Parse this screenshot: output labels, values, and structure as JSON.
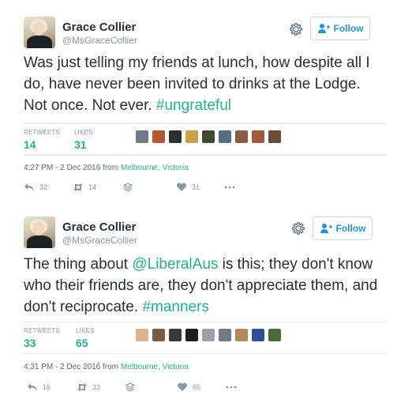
{
  "tweets": [
    {
      "author": {
        "name": "Grace Collier",
        "handle": "@MsGraceCollier"
      },
      "follow_label": "Follow",
      "text": {
        "before": "Was just telling my friends at lunch, how despite all I do, have never been invited to drinks at the Lodge. Not once. Not ever. ",
        "hashtag": "#ungrateful",
        "after": ""
      },
      "stats": {
        "retweets_label": "RETWEETS",
        "retweets": "14",
        "likes_label": "LIKES",
        "likes": "31"
      },
      "timestamp": "4:27 PM - 2 Dec 2016 from",
      "location": "Melbourne, Victoria",
      "actions": {
        "reply": "32",
        "retweet": "14",
        "like": "31"
      },
      "likers": [
        "#6d7b88",
        "#b5572f",
        "#2f2f2f",
        "#c9a14a",
        "#3f4a35",
        "#596e84",
        "#8c5b45",
        "#a4593c",
        "#6e4c3a"
      ]
    },
    {
      "author": {
        "name": "Grace Collier",
        "handle": "@MsGraceCollier"
      },
      "follow_label": "Follow",
      "text": {
        "before": "The thing about ",
        "mention": "@LiberalAus",
        "middle": " is this; they don't know who their friends are, they don't appreciate them, and don't reciprocate. ",
        "hashtag": "#manners",
        "after": ""
      },
      "stats": {
        "retweets_label": "RETWEETS",
        "retweets": "33",
        "likes_label": "LIKES",
        "likes": "65"
      },
      "timestamp": "4:31 PM - 2 Dec 2016 from",
      "location": "Melbourne, Victoria",
      "actions": {
        "reply": "16",
        "retweet": "33",
        "like": "65"
      },
      "likers": [
        "#d9b38c",
        "#7a5a43",
        "#3a3a3a",
        "#1f1f1f",
        "#9aa0a6",
        "#6f7a84",
        "#b08a5a",
        "#2c4f9c",
        "#4d6b3a"
      ]
    }
  ],
  "colors": {
    "accent": "#1db58f",
    "follow": "#1b95e0",
    "muted": "#8899a6"
  }
}
